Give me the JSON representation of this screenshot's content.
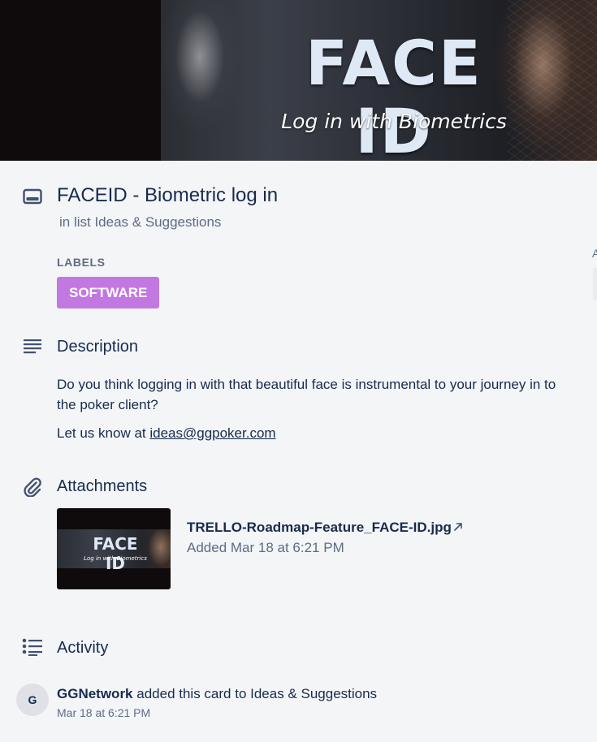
{
  "cover": {
    "title": "FACE ID",
    "subtitle": "Log in with Biometrics"
  },
  "card": {
    "title": "FACEID - Biometric log in",
    "list_text": "in list Ideas & Suggestions"
  },
  "labels": {
    "heading": "LABELS",
    "items": [
      {
        "text": "SOFTWARE",
        "color": "#c377e0"
      }
    ]
  },
  "sidebar_fragment": {
    "text": "A"
  },
  "description": {
    "heading": "Description",
    "paragraph1": "Do you think logging in with that beautiful face is instrumental to your journey in to the poker client?",
    "paragraph2_prefix": "Let us know at ",
    "email": "ideas@ggpoker.com"
  },
  "attachments": {
    "heading": "Attachments",
    "items": [
      {
        "thumb_title": "FACE ID",
        "thumb_subtitle": "Log in with Biometrics",
        "name": "TRELLO-Roadmap-Feature_FACE-ID.jpg",
        "open_icon": "external-link-arrow",
        "added": "Added Mar 18 at 6:21 PM"
      }
    ]
  },
  "activity": {
    "heading": "Activity",
    "items": [
      {
        "avatar_initial": "G",
        "user": "GGNetwork",
        "action": " added this card to Ideas & Suggestions",
        "time": "Mar 18 at 6:21 PM"
      }
    ]
  },
  "icons": {
    "card": "card-icon",
    "description": "description-lines-icon",
    "attachment": "paperclip-icon",
    "activity": "activity-list-icon"
  },
  "colors": {
    "background": "#f4f5f7",
    "text": "#172b4d",
    "muted": "#5e6c84",
    "label_purple": "#c377e0"
  }
}
